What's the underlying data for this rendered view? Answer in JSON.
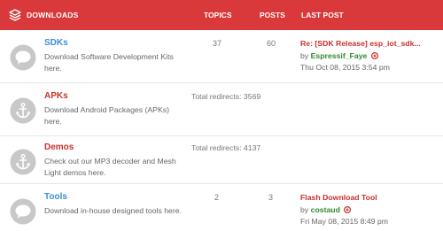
{
  "header": {
    "title": "DOWNLOADS",
    "col_topics": "TOPICS",
    "col_posts": "POSTS",
    "col_last_post": "LAST POST",
    "icon": "layers-icon"
  },
  "colors": {
    "header_bg": "#d9393a",
    "link_blue": "#3a8fd6",
    "link_red": "#c9302c",
    "user_green": "#2e8b2e",
    "user_red": "#c9302c",
    "icon_gray": "#c8c8c8"
  },
  "forums": [
    {
      "name": "SDKs",
      "description": "Download Software Development Kits here.",
      "topics": "37",
      "posts": "60",
      "redirects": "",
      "icon": "chat-bubble-icon",
      "last_post": {
        "title": "Re: [SDK Release] esp_iot_sdk...",
        "by": "by",
        "user": "Espressif_Faye",
        "date": "Thu Oct 08, 2015 3:54 pm"
      }
    },
    {
      "name": "APKs",
      "description": "Download Android Packages (APKs) here.",
      "topics": "",
      "posts": "",
      "redirects": "Total redirects: 3569",
      "icon": "anchor-icon"
    },
    {
      "name": "Demos",
      "description": "Check out our MP3 decoder and Mesh Light demos here.",
      "topics": "",
      "posts": "",
      "redirects": "Total redirects: 4137",
      "icon": "anchor-icon"
    },
    {
      "name": "Tools",
      "description": "Download in-house designed tools here.",
      "topics": "2",
      "posts": "3",
      "redirects": "",
      "icon": "chat-bubble-icon",
      "last_post": {
        "title": "Flash Download Tool",
        "by": "by",
        "user": "costaud",
        "date": "Fri May 08, 2015 8:49 pm"
      }
    }
  ]
}
